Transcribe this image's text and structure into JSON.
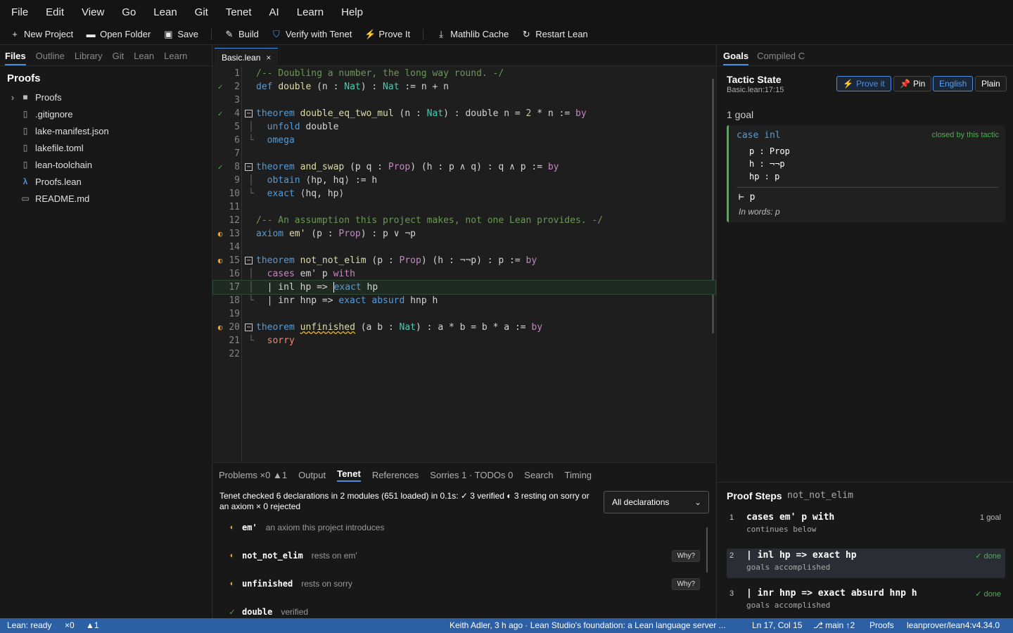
{
  "menu": [
    "File",
    "Edit",
    "View",
    "Go",
    "Lean",
    "Git",
    "Tenet",
    "AI",
    "Learn",
    "Help"
  ],
  "toolbar": {
    "new_project": "New Project",
    "open_folder": "Open Folder",
    "save": "Save",
    "build": "Build",
    "verify": "Verify with Tenet",
    "prove": "Prove It",
    "mathlib": "Mathlib Cache",
    "restart": "Restart Lean"
  },
  "sidebar": {
    "tabs": [
      "Files",
      "Outline",
      "Library",
      "Git",
      "Lean",
      "Learn"
    ],
    "heading": "Proofs",
    "tree": [
      {
        "name": "Proofs",
        "kind": "folder"
      },
      {
        "name": ".gitignore",
        "kind": "file"
      },
      {
        "name": "lake-manifest.json",
        "kind": "file"
      },
      {
        "name": "lakefile.toml",
        "kind": "file"
      },
      {
        "name": "lean-toolchain",
        "kind": "file"
      },
      {
        "name": "Proofs.lean",
        "kind": "lean"
      },
      {
        "name": "README.md",
        "kind": "book"
      }
    ]
  },
  "editor": {
    "tab": "Basic.lean",
    "close": "×"
  },
  "bottom": {
    "tabs": [
      "Problems ×0 ▲1",
      "Output",
      "Tenet",
      "References",
      "Sorries 1 · TODOs 0",
      "Search",
      "Timing"
    ],
    "summary": "Tenet checked 6 declarations in 2 modules (651 loaded) in 0.1s:  ✓ 3 verified   ◐ 3 resting on sorry or an axiom   × 0 rejected",
    "dropdown": "All declarations",
    "why": "Why?",
    "decls": [
      {
        "name": "em'",
        "desc": "an axiom this project introduces",
        "status": "warn"
      },
      {
        "name": "not_not_elim",
        "desc": "rests on em'",
        "status": "warn"
      },
      {
        "name": "unfinished",
        "desc": "rests on sorry",
        "status": "warn"
      },
      {
        "name": "double",
        "desc": "verified",
        "status": "ok"
      }
    ]
  },
  "right": {
    "tabs": [
      "Goals",
      "Compiled C"
    ],
    "title": "Tactic State",
    "location": "Basic.lean:17:15",
    "prove_btn": "Prove it",
    "pin_btn": "Pin",
    "english_btn": "English",
    "plain_btn": "Plain",
    "goal_count": "1 goal",
    "goal": {
      "case": "case inl",
      "closed": "closed by this tactic",
      "hyps": [
        "p : Prop",
        "h : ¬¬p",
        "hp : p"
      ],
      "target": "⊢ p",
      "words": "In words: p"
    },
    "proof_steps_title": "Proof Steps",
    "proof_steps_sub": "not_not_elim",
    "steps": [
      {
        "n": "1",
        "code": "cases em' p with",
        "note": "continues below",
        "right": "1 goal"
      },
      {
        "n": "2",
        "code": "| inl hp => exact hp",
        "note": "goals accomplished",
        "right": "✓ done"
      },
      {
        "n": "3",
        "code": "| inr hnp => exact absurd hnp h",
        "note": "goals accomplished",
        "right": "✓ done"
      }
    ]
  },
  "status": {
    "lean": "Lean: ready",
    "errors": "×0",
    "warnings": "▲1",
    "commit": "Keith Adler, 3 h ago · Lean Studio's foundation: a Lean language server ...",
    "pos": "Ln 17, Col 15",
    "branch": "⎇ main ↑2",
    "project": "Proofs",
    "toolchain": "leanprover/lean4:v4.34.0"
  },
  "colors": {
    "accent": "#4a90e2",
    "ok": "#4caf50",
    "warn": "#e6a23c",
    "statusbar": "#2c5fa3"
  }
}
